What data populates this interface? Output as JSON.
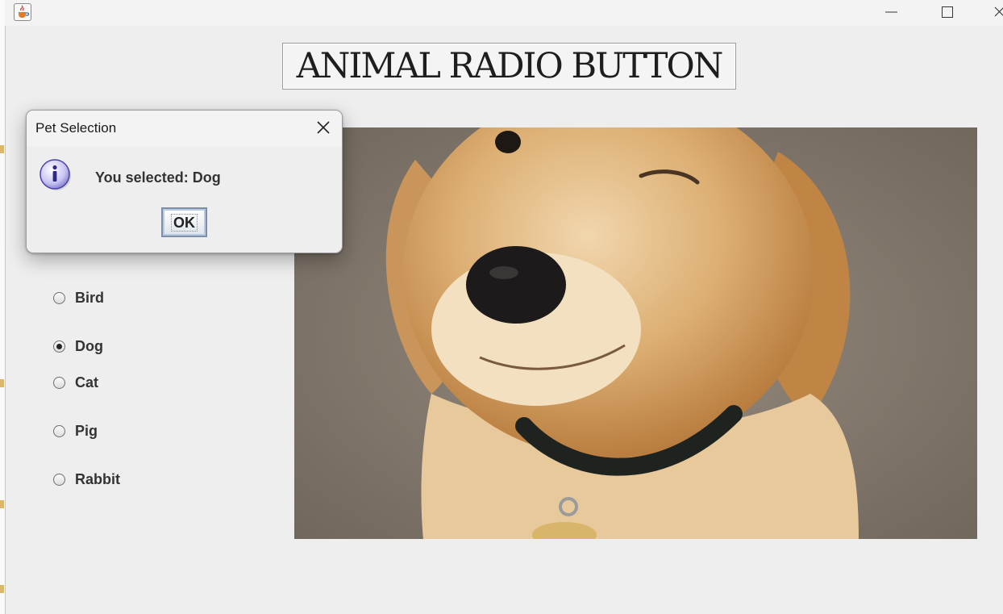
{
  "window": {
    "app_icon": "java-coffee-icon",
    "controls": [
      "minimize-icon",
      "maximize-icon",
      "close-icon"
    ]
  },
  "banner": {
    "title": "ANIMAL RADIO BUTTON"
  },
  "radio_group": {
    "options": [
      {
        "label": "Bird",
        "checked": false
      },
      {
        "label": "Dog",
        "checked": true
      },
      {
        "label": "Cat",
        "checked": false
      },
      {
        "label": "Pig",
        "checked": false
      },
      {
        "label": "Rabbit",
        "checked": false
      }
    ]
  },
  "photo": {
    "subject": "golden retriever puppy"
  },
  "dialog": {
    "title": "Pet Selection",
    "icon": "info-icon",
    "message": "You selected: Dog",
    "ok_label": "OK"
  }
}
